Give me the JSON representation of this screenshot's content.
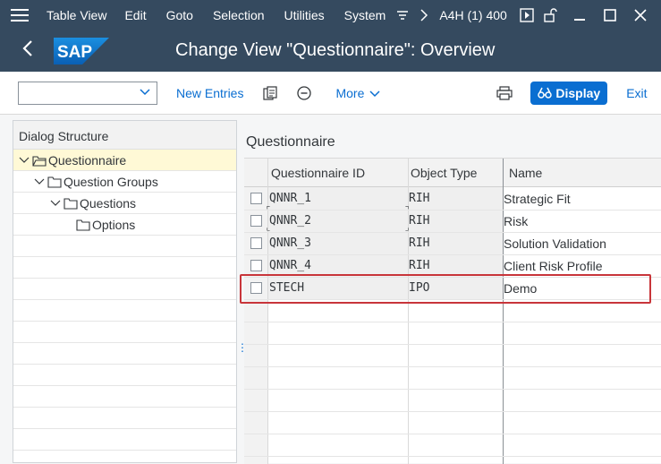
{
  "menubar": {
    "items": [
      "Table View",
      "Edit",
      "Goto",
      "Selection",
      "Utilities",
      "System"
    ],
    "system_id": "A4H (1) 400"
  },
  "titlebar": {
    "logo_text": "SAP",
    "title": "Change View \"Questionnaire\": Overview"
  },
  "toolbar": {
    "combo_value": "",
    "new_entries": "New Entries",
    "more": "More",
    "display": "Display",
    "exit": "Exit"
  },
  "dialog_structure": {
    "header": "Dialog Structure",
    "nodes": [
      {
        "label": "Questionnaire",
        "level": 0,
        "selected": true
      },
      {
        "label": "Question Groups",
        "level": 1
      },
      {
        "label": "Questions",
        "level": 2
      },
      {
        "label": "Options",
        "level": 3
      }
    ]
  },
  "table": {
    "heading": "Questionnaire",
    "columns": [
      "Questionnaire ID",
      "Object Type",
      "Name"
    ],
    "rows": [
      {
        "id": "QNNR_1",
        "object_type": "RIH",
        "name": "Strategic Fit"
      },
      {
        "id": "QNNR_2",
        "object_type": "RIH",
        "name": "Risk"
      },
      {
        "id": "QNNR_3",
        "object_type": "RIH",
        "name": "Solution Validation"
      },
      {
        "id": "QNNR_4",
        "object_type": "RIH",
        "name": "Client Risk Profile"
      },
      {
        "id": "STECH",
        "object_type": "IPO",
        "name": "Demo"
      }
    ]
  },
  "colors": {
    "shell": "#354a5f",
    "accent": "#0a6ed1",
    "highlight": "#c8353a",
    "selected_node": "#fff9d6"
  }
}
